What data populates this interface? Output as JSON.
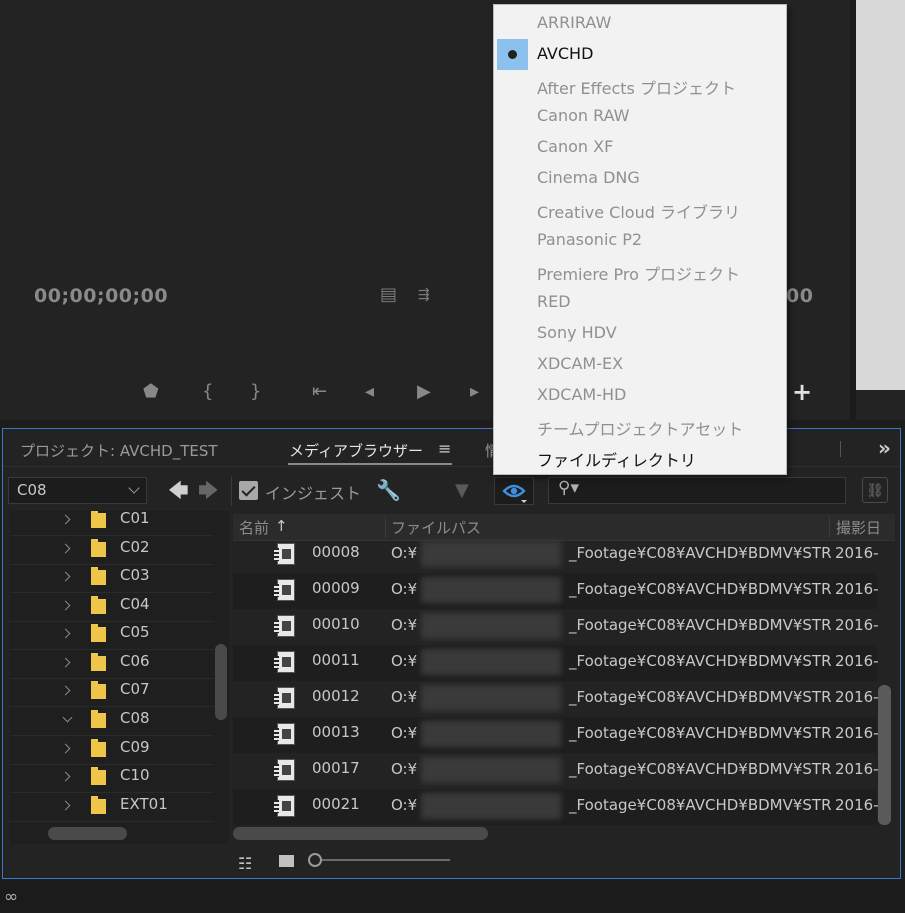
{
  "monitor": {
    "timecode_left": "00;00;00;00",
    "timecode_right": "00",
    "add_button_label": "+"
  },
  "panel": {
    "tabs": [
      {
        "label": "プロジェクト: AVCHD_TEST",
        "active": false
      },
      {
        "label": "メディアブラウザー",
        "active": true
      },
      {
        "label": "情",
        "active": false
      }
    ],
    "tab_menu_glyph": "≡",
    "expand_glyph": "»"
  },
  "toolbar": {
    "location_value": "C08",
    "back_glyph": "🡄",
    "forward_glyph": "🡆",
    "ingest_label": "インジェスト",
    "ingest_checked": true,
    "search_placeholder": ""
  },
  "tree": {
    "items": [
      {
        "label": "C01",
        "expanded": false
      },
      {
        "label": "C02",
        "expanded": false
      },
      {
        "label": "C03",
        "expanded": false
      },
      {
        "label": "C04",
        "expanded": false
      },
      {
        "label": "C05",
        "expanded": false
      },
      {
        "label": "C06",
        "expanded": false
      },
      {
        "label": "C07",
        "expanded": false
      },
      {
        "label": "C08",
        "expanded": true
      },
      {
        "label": "C09",
        "expanded": false
      },
      {
        "label": "C10",
        "expanded": false
      },
      {
        "label": "EXT01",
        "expanded": false
      }
    ]
  },
  "list": {
    "headers": {
      "name": "名前",
      "sort_glyph": "↑",
      "path": "ファイルパス",
      "date": "撮影日"
    },
    "rows": [
      {
        "name": "00008",
        "path_prefix": "O:¥",
        "path_suffix": "_Footage¥C08¥AVCHD¥BDMV¥STR",
        "date": "2016-"
      },
      {
        "name": "00009",
        "path_prefix": "O:¥",
        "path_suffix": "_Footage¥C08¥AVCHD¥BDMV¥STR",
        "date": "2016-"
      },
      {
        "name": "00010",
        "path_prefix": "O:¥",
        "path_suffix": "_Footage¥C08¥AVCHD¥BDMV¥STR",
        "date": "2016-"
      },
      {
        "name": "00011",
        "path_prefix": "O:¥",
        "path_suffix": "_Footage¥C08¥AVCHD¥BDMV¥STR",
        "date": "2016-"
      },
      {
        "name": "00012",
        "path_prefix": "O:¥",
        "path_suffix": "_Footage¥C08¥AVCHD¥BDMV¥STR",
        "date": "2016-"
      },
      {
        "name": "00013",
        "path_prefix": "O:¥",
        "path_suffix": "_Footage¥C08¥AVCHD¥BDMV¥STR",
        "date": "2016-"
      },
      {
        "name": "00017",
        "path_prefix": "O:¥",
        "path_suffix": "_Footage¥C08¥AVCHD¥BDMV¥STR",
        "date": "2016-"
      },
      {
        "name": "00021",
        "path_prefix": "O:¥",
        "path_suffix": "_Footage¥C08¥AVCHD¥BDMV¥STR",
        "date": "2016-"
      }
    ]
  },
  "menu": {
    "items": [
      {
        "label": "ARRIRAW",
        "enabled": false,
        "checked": false
      },
      {
        "label": "AVCHD",
        "enabled": true,
        "checked": true
      },
      {
        "label": "After Effects プロジェクト",
        "enabled": false,
        "checked": false
      },
      {
        "label": "Canon RAW",
        "enabled": false,
        "checked": false
      },
      {
        "label": "Canon XF",
        "enabled": false,
        "checked": false
      },
      {
        "label": "Cinema DNG",
        "enabled": false,
        "checked": false
      },
      {
        "label": "Creative Cloud ライブラリ",
        "enabled": false,
        "checked": false
      },
      {
        "label": "Panasonic P2",
        "enabled": false,
        "checked": false
      },
      {
        "label": "Premiere Pro プロジェクト",
        "enabled": false,
        "checked": false
      },
      {
        "label": "RED",
        "enabled": false,
        "checked": false
      },
      {
        "label": "Sony HDV",
        "enabled": false,
        "checked": false
      },
      {
        "label": "XDCAM-EX",
        "enabled": false,
        "checked": false
      },
      {
        "label": "XDCAM-HD",
        "enabled": false,
        "checked": false
      },
      {
        "label": "チームプロジェクトアセット",
        "enabled": false,
        "checked": false
      },
      {
        "label": "ファイルディレクトリ",
        "enabled": true,
        "checked": false
      }
    ]
  },
  "colors": {
    "panel_border": "#3a78c8",
    "menu_check_bg": "#8cc1ee",
    "eye_icon": "#3d8fe0",
    "folder": "#f0c64a"
  }
}
